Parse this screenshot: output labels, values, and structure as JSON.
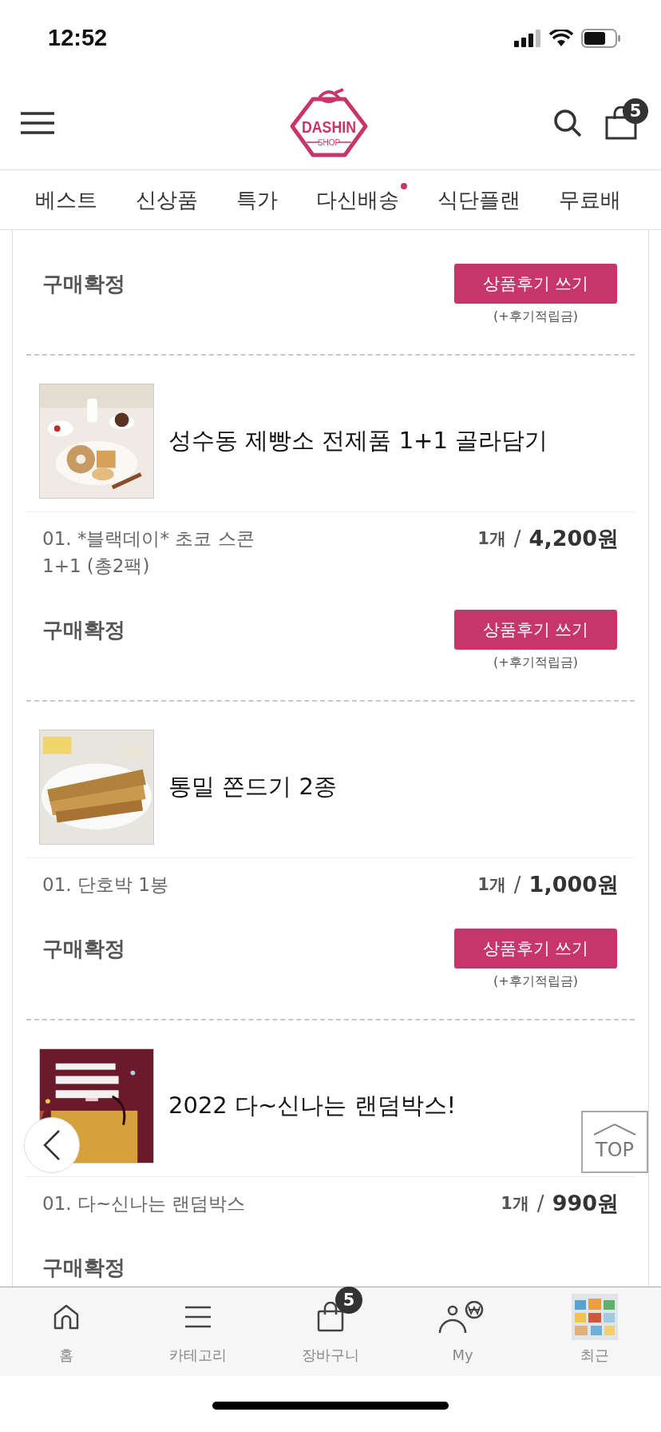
{
  "status_bar": {
    "time": "12:52"
  },
  "header": {
    "logo": {
      "name": "DASHIN",
      "sub": "SHOP"
    },
    "cart_count": "5"
  },
  "tabs": [
    {
      "label": "베스트",
      "selected": false,
      "dot": false
    },
    {
      "label": "신상품",
      "selected": false,
      "dot": false
    },
    {
      "label": "특가",
      "selected": false,
      "dot": false
    },
    {
      "label": "다신배송",
      "selected": false,
      "dot": true
    },
    {
      "label": "식단플랜",
      "selected": false,
      "dot": false
    },
    {
      "label": "무료배",
      "selected": false,
      "dot": false
    }
  ],
  "orders": [
    {
      "status": "구매확정",
      "review_button": "상품후기 쓰기",
      "review_note": "(+후기적립금)"
    },
    {
      "title": "성수동 제빵소 전제품 1+1 골라담기",
      "options": [
        {
          "name": "01. *블랙데이* 초코 스콘\n1+1 (총2팩)",
          "qty": "1개",
          "separator": "/",
          "price": "4,200원"
        }
      ],
      "status": "구매확정",
      "review_button": "상품후기 쓰기",
      "review_note": "(+후기적립금)"
    },
    {
      "title": "통밀 쫀드기 2종",
      "options": [
        {
          "name": "01. 단호박 1봉",
          "qty": "1개",
          "separator": "/",
          "price": "1,000원"
        }
      ],
      "status": "구매확정",
      "review_button": "상품후기 쓰기",
      "review_note": "(+후기적립금)"
    },
    {
      "title": "2022 다~신나는 랜덤박스!",
      "options": [
        {
          "name": "01. 다~신나는 랜덤박스",
          "qty": "1개",
          "separator": "/",
          "price": "990원"
        }
      ],
      "status": "구매확정"
    }
  ],
  "top_button": "TOP",
  "bottom_nav": [
    {
      "kind": "home",
      "label": "홈"
    },
    {
      "kind": "category",
      "label": "카테고리"
    },
    {
      "kind": "cart",
      "label": "장바구니",
      "badge": "5"
    },
    {
      "kind": "my",
      "label": "My"
    },
    {
      "kind": "recent",
      "label": "최근"
    }
  ]
}
